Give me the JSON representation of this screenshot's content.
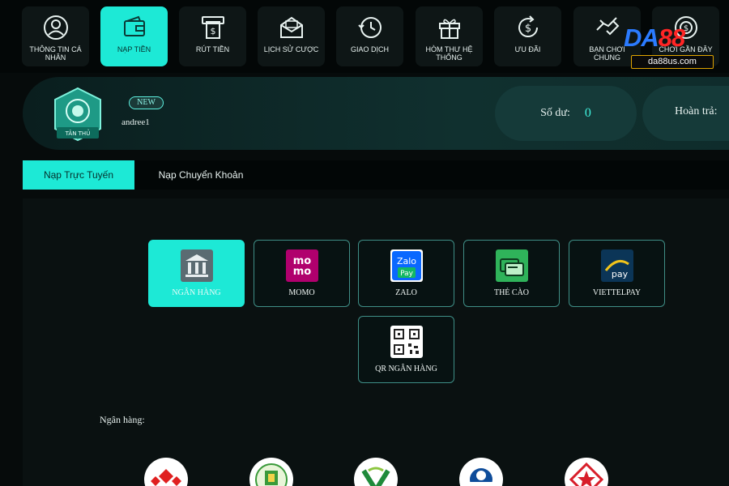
{
  "nav": {
    "items": [
      {
        "label": "THÔNG TIN CÁ NHÂN",
        "icon": "user-icon"
      },
      {
        "label": "NẠP TIỀN",
        "icon": "wallet-icon",
        "active": true
      },
      {
        "label": "RÚT TIỀN",
        "icon": "atm-withdraw-icon"
      },
      {
        "label": "LỊCH SỬ CƯỢC",
        "icon": "mail-history-icon"
      },
      {
        "label": "GIAO DỊCH",
        "icon": "clock-history-icon"
      },
      {
        "label": "HÒM THƯ HỆ THỐNG",
        "icon": "gift-box-icon"
      },
      {
        "label": "ƯU ĐÃI",
        "icon": "dollar-cycle-icon"
      },
      {
        "label": "BẠN CHƠI CHUNG",
        "icon": "handshake-icon"
      },
      {
        "label": "CHƠI GẦN ĐÂY",
        "icon": "chip-icon"
      }
    ]
  },
  "brand": {
    "logo_da": "DA",
    "logo_88": "88",
    "url": "da88us.com"
  },
  "profile": {
    "badge_text": "TÂN THỦ",
    "new_label": "NEW",
    "username": "andree1",
    "balance_label": "Số dư:",
    "balance_value": "0",
    "refund_label": "Hoàn trả:"
  },
  "tabs": {
    "online": "Nạp Trực Tuyến",
    "transfer": "Nạp Chuyển Khoản"
  },
  "methods": [
    {
      "label": "NGÂN HÀNG",
      "icon": "bank-icon",
      "active": true
    },
    {
      "label": "MOMO",
      "icon": "momo-icon"
    },
    {
      "label": "ZALO",
      "icon": "zalopay-icon"
    },
    {
      "label": "THẺ CÀO",
      "icon": "scratch-card-icon"
    },
    {
      "label": "VIETTELPAY",
      "icon": "viettelpay-icon"
    },
    {
      "label": "QR NGÂN HÀNG",
      "icon": "qr-code-icon"
    }
  ],
  "bank_section": {
    "label": "Ngân hàng:"
  },
  "colors": {
    "accent": "#1de9d6",
    "background": "#060b0b",
    "panel": "#153a39"
  }
}
